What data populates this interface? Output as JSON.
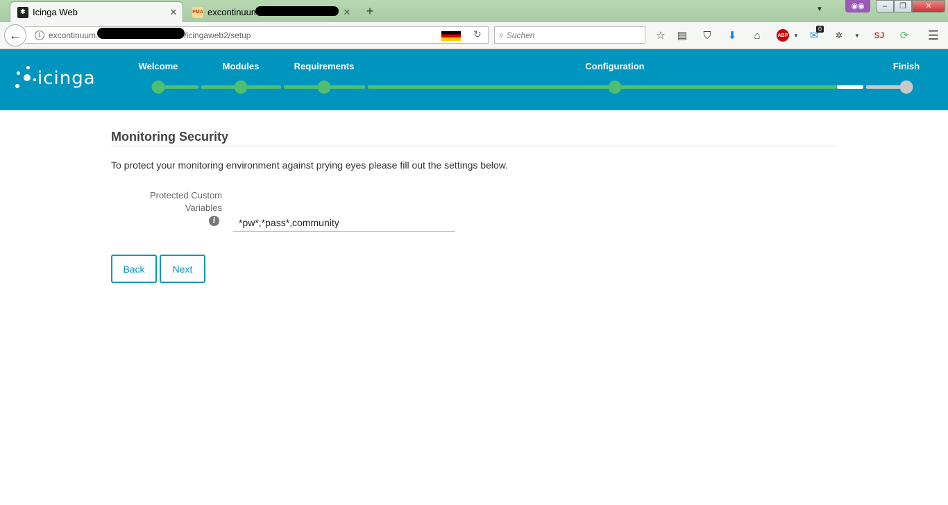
{
  "browser": {
    "tabs": [
      {
        "title": "Icinga Web",
        "favicon": "icinga-favicon",
        "active": true
      },
      {
        "title": "excontinuum.",
        "favicon": "phpmyadmin-favicon",
        "favicon_text": "PMA",
        "active": false
      }
    ],
    "url_host": "excontinuum.",
    "url_path": "/icingaweb2/setup",
    "search_placeholder": "Suchen",
    "notification_count": "0",
    "abp_label": "ABP",
    "privacy_icon": "mask-icon"
  },
  "icinga": {
    "logo_text": "icinga",
    "steps": [
      {
        "label": "Welcome"
      },
      {
        "label": "Modules"
      },
      {
        "label": "Requirements"
      },
      {
        "label": "Configuration"
      },
      {
        "label": "Finish"
      }
    ]
  },
  "page": {
    "title": "Monitoring Security",
    "intro": "To protect your monitoring environment against prying eyes please fill out the settings below.",
    "field_label_line1": "Protected Custom",
    "field_label_line2": "Variables",
    "field_value": "*pw*,*pass*,community",
    "back_label": "Back",
    "next_label": "Next"
  },
  "colors": {
    "header_bg": "#0095bf",
    "progress_done": "#4fbf6f",
    "progress_todo": "#ffffff",
    "progress_current": "#c8c8c8"
  }
}
